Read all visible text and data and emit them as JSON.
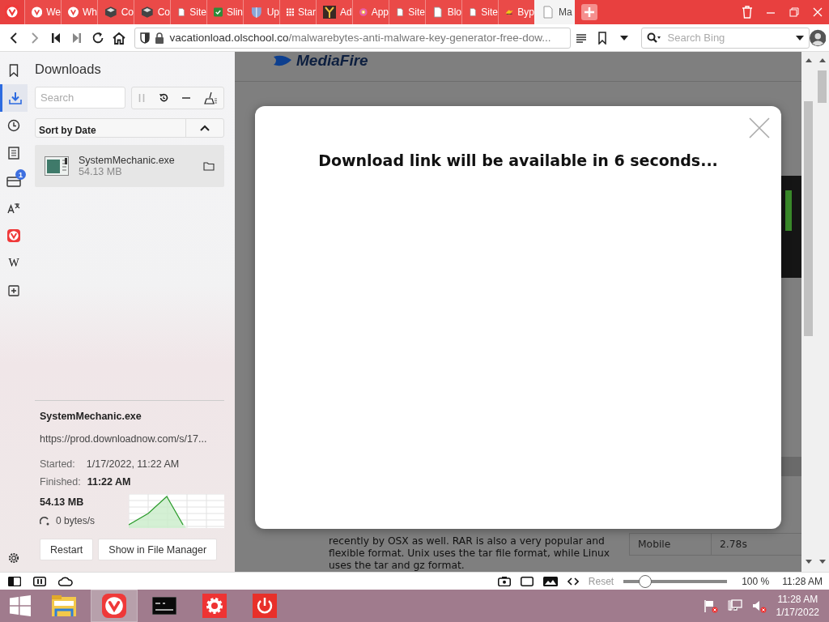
{
  "tabs": [
    {
      "label": "We",
      "kind": "vivaldi",
      "selected": false
    },
    {
      "label": "Wh",
      "kind": "vivaldi",
      "selected": false
    },
    {
      "label": "Co",
      "kind": "cube",
      "selected": false
    },
    {
      "label": "Co",
      "kind": "cube",
      "selected": false
    },
    {
      "label": "Site",
      "kind": "page",
      "selected": false
    },
    {
      "label": "Slin",
      "kind": "green",
      "selected": false
    },
    {
      "label": "Up",
      "kind": "shield",
      "selected": false
    },
    {
      "label": "Star",
      "kind": "grid",
      "selected": false
    },
    {
      "label": "Ad",
      "kind": "letter",
      "selected": false
    },
    {
      "label": "App",
      "kind": "flower",
      "selected": false
    },
    {
      "label": "Site",
      "kind": "page",
      "selected": false
    },
    {
      "label": "Blo",
      "kind": "page",
      "selected": false
    },
    {
      "label": "Site",
      "kind": "page",
      "selected": false
    },
    {
      "label": "Byp",
      "kind": "bird",
      "selected": false
    },
    {
      "label": "Ma",
      "kind": "page",
      "selected": true
    }
  ],
  "address_bar": {
    "host": "vacationload.olschool.co",
    "path": "/malwarebytes-anti-malware-key-generator-free-dow...",
    "search_placeholder": "Search Bing"
  },
  "sidebar": {
    "panels": [
      {
        "kind": "bookmarks",
        "selected": false
      },
      {
        "kind": "downloads",
        "selected": true
      },
      {
        "kind": "history",
        "selected": false
      },
      {
        "kind": "notes",
        "selected": false
      },
      {
        "kind": "mail",
        "selected": false,
        "badge": "1"
      },
      {
        "kind": "translate",
        "selected": false
      },
      {
        "kind": "vivaldi",
        "selected": false
      },
      {
        "kind": "wikipedia",
        "selected": false,
        "label": "W"
      },
      {
        "kind": "add",
        "selected": false
      }
    ]
  },
  "downloads": {
    "title": "Downloads",
    "search_placeholder": "Search",
    "sort_label": "Sort by Date",
    "items": [
      {
        "name": "SystemMechanic.exe",
        "size": "54.13 MB",
        "selected": true
      }
    ],
    "details": {
      "name": "SystemMechanic.exe",
      "url": "https://prod.downloadnow.com/s/17...",
      "started_label": "Started:",
      "started": "1/17/2022, 11:22 AM",
      "finished_label": "Finished:",
      "finished": "11:22 AM",
      "size": "54.13 MB",
      "speed": "0 bytes/s",
      "buttons": [
        "Restart",
        "Show in File Manager"
      ]
    }
  },
  "page": {
    "logo": "MediaFire",
    "paragraph": "recently by OSX as well. RAR is also a very popular and flexible format. Unix uses the tar file format, while Linux uses the tar and gz format.",
    "table_rows": [
      {
        "cells": [
          "Mobile",
          "2.78s"
        ]
      }
    ]
  },
  "modal": {
    "message": "Download link will be available in 6 seconds..."
  },
  "status_bar": {
    "reset": "Reset",
    "zoom": {
      "level": 0.21
    },
    "zoom_reading": "100 %",
    "clock": "11:28 AM"
  },
  "taskbar": {
    "apps": [
      {
        "kind": "explorer",
        "selected": false
      },
      {
        "kind": "vivaldi",
        "selected": true
      },
      {
        "kind": "terminal",
        "selected": false
      },
      {
        "kind": "gear",
        "selected": false
      },
      {
        "kind": "power",
        "selected": false
      }
    ],
    "time": "11:28 AM",
    "date": "1/17/2022"
  }
}
